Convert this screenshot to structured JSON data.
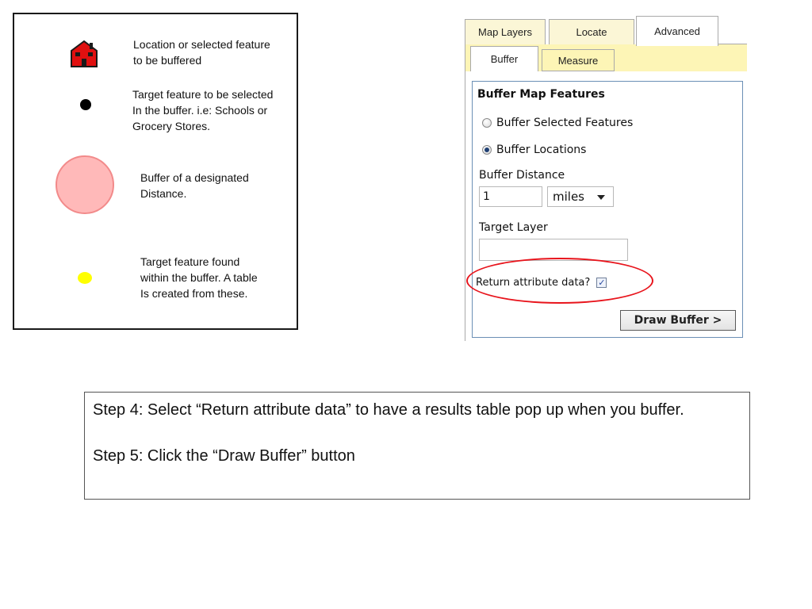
{
  "legend": {
    "items": [
      {
        "icon": "house-icon",
        "lines": [
          "Location or selected feature",
          "to be buffered"
        ]
      },
      {
        "icon": "black-dot-icon",
        "lines": [
          "Target feature to be selected",
          "In the buffer. i.e: Schools or",
          "Grocery Stores."
        ]
      },
      {
        "icon": "buffer-circle-icon",
        "lines": [
          "Buffer of a designated",
          "Distance."
        ]
      },
      {
        "icon": "yellow-dot-icon",
        "lines": [
          "Target feature found",
          "within the buffer. A table",
          "Is created from these."
        ]
      }
    ],
    "colors": {
      "house": "#e01010",
      "buffer_fill": "#ffb9b9",
      "buffer_border": "#f28a8a",
      "found": "#ffff00"
    }
  },
  "panel": {
    "tabs": [
      "Map Layers",
      "Locate",
      "Advanced"
    ],
    "active_tab": "Advanced",
    "subtabs": [
      "Buffer",
      "Measure"
    ],
    "active_subtab": "Buffer",
    "form": {
      "title": "Buffer Map Features",
      "radio_selected_features": "Buffer Selected Features",
      "radio_locations": "Buffer Locations",
      "selected_radio": "Buffer Locations",
      "distance_label": "Buffer Distance",
      "distance_value": "1",
      "unit_value": "miles",
      "target_layer_label": "Target Layer",
      "target_layer_value": "",
      "return_attr_label": "Return attribute data?",
      "return_attr_checked": true,
      "draw_button": "Draw Buffer >"
    },
    "colors": {
      "tab_bg": "#fbf6d6",
      "subtab_strip": "#fdf5b6",
      "form_border": "#6b8fb5",
      "highlight": "#e8141c"
    }
  },
  "instructions": {
    "step4": "Step 4: Select “Return attribute data” to have a results table pop up when you buffer.",
    "step5": "Step 5: Click the “Draw Buffer” button"
  }
}
